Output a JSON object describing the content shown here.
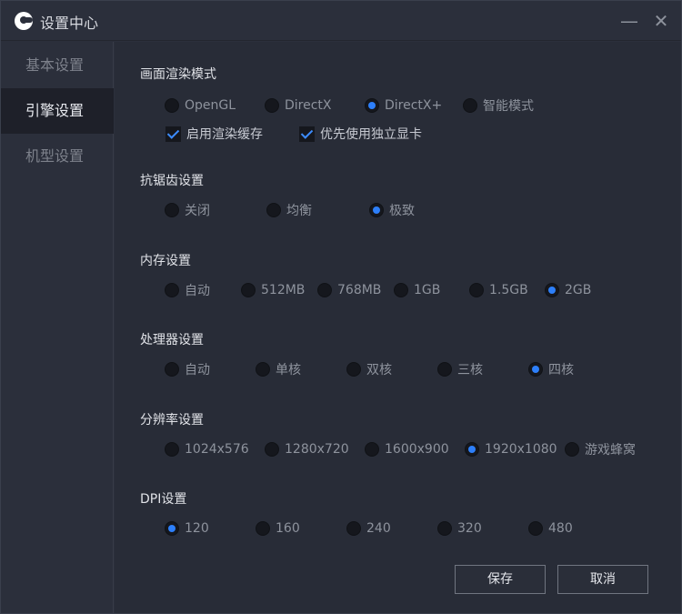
{
  "window": {
    "title": "设置中心",
    "minimize_glyph": "—",
    "close_glyph": "✕"
  },
  "sidebar": {
    "items": [
      {
        "label": "基本设置",
        "active": false
      },
      {
        "label": "引擎设置",
        "active": true
      },
      {
        "label": "机型设置",
        "active": false
      }
    ]
  },
  "sections": {
    "render": {
      "title": "画面渲染模式",
      "options": [
        "OpenGL",
        "DirectX",
        "DirectX+",
        "智能模式"
      ],
      "selected": "DirectX+",
      "checkboxes": [
        {
          "label": "启用渲染缓存",
          "checked": true
        },
        {
          "label": "优先使用独立显卡",
          "checked": true
        }
      ]
    },
    "antialias": {
      "title": "抗锯齿设置",
      "options": [
        "关闭",
        "均衡",
        "极致"
      ],
      "selected": "极致"
    },
    "memory": {
      "title": "内存设置",
      "options": [
        "自动",
        "512MB",
        "768MB",
        "1GB",
        "1.5GB",
        "2GB"
      ],
      "selected": "2GB"
    },
    "cpu": {
      "title": "处理器设置",
      "options": [
        "自动",
        "单核",
        "双核",
        "三核",
        "四核"
      ],
      "selected": "四核"
    },
    "resolution": {
      "title": "分辨率设置",
      "options": [
        "1024x576",
        "1280x720",
        "1600x900",
        "1920x1080",
        "游戏蜂窝"
      ],
      "selected": "1920x1080"
    },
    "dpi": {
      "title": "DPI设置",
      "options": [
        "120",
        "160",
        "240",
        "320",
        "480"
      ],
      "selected": "120"
    }
  },
  "buttons": {
    "save": "保存",
    "cancel": "取消"
  },
  "colors": {
    "accent": "#2d7ff9",
    "background": "#282c37",
    "sidebar_active": "#1e2029"
  }
}
